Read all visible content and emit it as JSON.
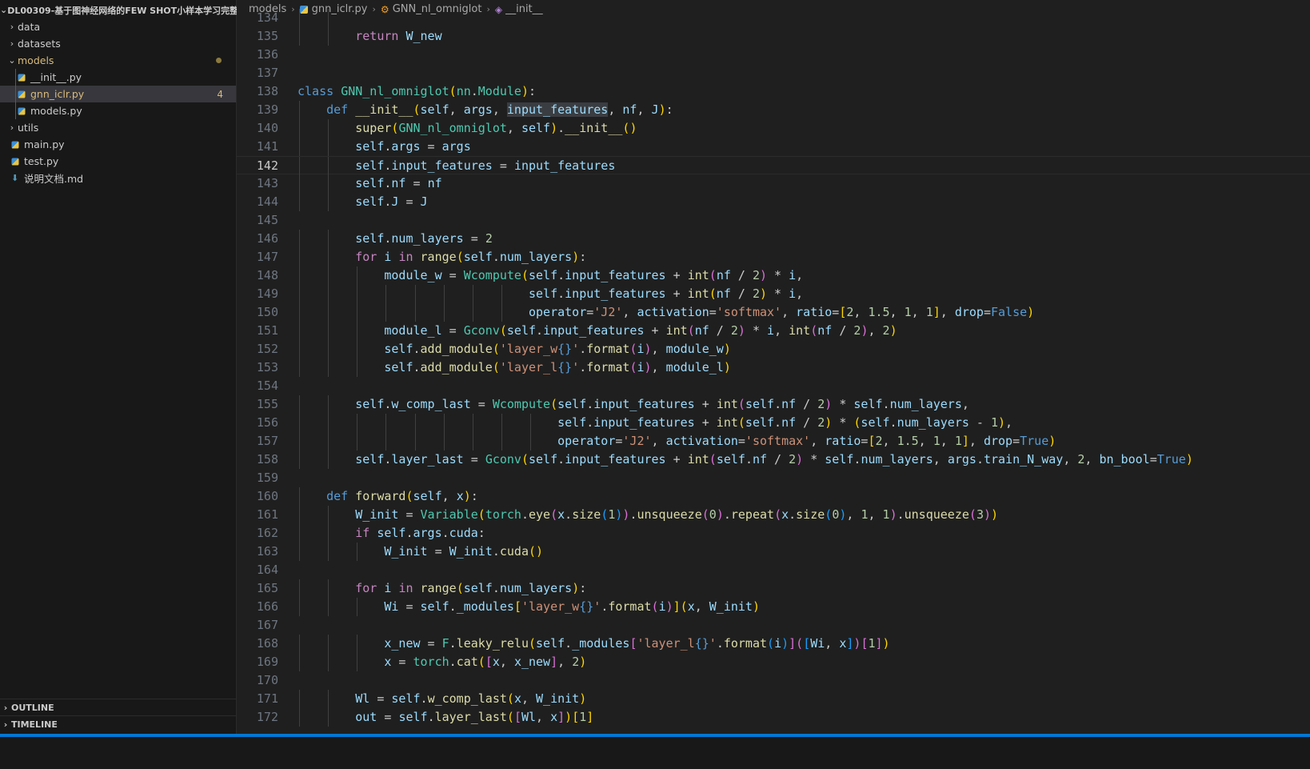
{
  "sidebar": {
    "root": "DL00309-基于图神经网络的FEW SHOT小样本学习完整...",
    "items": [
      {
        "label": "data",
        "type": "folder"
      },
      {
        "label": "datasets",
        "type": "folder"
      },
      {
        "label": "models",
        "type": "folder-open"
      },
      {
        "label": "__init__.py",
        "type": "py"
      },
      {
        "label": "gnn_iclr.py",
        "type": "py",
        "badge": "4"
      },
      {
        "label": "models.py",
        "type": "py"
      },
      {
        "label": "utils",
        "type": "folder"
      },
      {
        "label": "main.py",
        "type": "py"
      },
      {
        "label": "test.py",
        "type": "py"
      },
      {
        "label": "说明文档.md",
        "type": "md"
      }
    ],
    "outline": "OUTLINE",
    "timeline": "TIMELINE"
  },
  "breadcrumb": {
    "parts": [
      "models",
      "gnn_iclr.py",
      "GNN_nl_omniglot",
      "__init__"
    ]
  },
  "editor": {
    "current_line": "142",
    "lines": [
      {
        "n": "134",
        "text": "        return W_new"
      },
      {
        "n": "135",
        "text": "        return W_new"
      },
      {
        "n": "136",
        "text": ""
      },
      {
        "n": "137",
        "text": ""
      },
      {
        "n": "138",
        "text": "class GNN_nl_omniglot(nn.Module):"
      },
      {
        "n": "139",
        "text": "    def __init__(self, args, input_features, nf, J):"
      },
      {
        "n": "140",
        "text": "        super(GNN_nl_omniglot, self).__init__()"
      },
      {
        "n": "141",
        "text": "        self.args = args"
      },
      {
        "n": "142",
        "text": "        self.input_features = input_features"
      },
      {
        "n": "143",
        "text": "        self.nf = nf"
      },
      {
        "n": "144",
        "text": "        self.J = J"
      },
      {
        "n": "145",
        "text": ""
      },
      {
        "n": "146",
        "text": "        self.num_layers = 2"
      },
      {
        "n": "147",
        "text": "        for i in range(self.num_layers):"
      },
      {
        "n": "148",
        "text": "            module_w = Wcompute(self.input_features + int(nf / 2) * i,"
      },
      {
        "n": "149",
        "text": "                                self.input_features + int(nf / 2) * i,"
      },
      {
        "n": "150",
        "text": "                                operator='J2', activation='softmax', ratio=[2, 1.5, 1, 1], drop=False)"
      },
      {
        "n": "151",
        "text": "            module_l = Gconv(self.input_features + int(nf / 2) * i, int(nf / 2), 2)"
      },
      {
        "n": "152",
        "text": "            self.add_module('layer_w{}'.format(i), module_w)"
      },
      {
        "n": "153",
        "text": "            self.add_module('layer_l{}'.format(i), module_l)"
      },
      {
        "n": "154",
        "text": ""
      },
      {
        "n": "155",
        "text": "        self.w_comp_last = Wcompute(self.input_features + int(self.nf / 2) * self.num_layers,"
      },
      {
        "n": "156",
        "text": "                                    self.input_features + int(self.nf / 2) * (self.num_layers - 1),"
      },
      {
        "n": "157",
        "text": "                                    operator='J2', activation='softmax', ratio=[2, 1.5, 1, 1], drop=True)"
      },
      {
        "n": "158",
        "text": "        self.layer_last = Gconv(self.input_features + int(self.nf / 2) * self.num_layers, args.train_N_way, 2, bn_bool=True)"
      },
      {
        "n": "159",
        "text": ""
      },
      {
        "n": "160",
        "text": "    def forward(self, x):"
      },
      {
        "n": "161",
        "text": "        W_init = Variable(torch.eye(x.size(1)).unsqueeze(0).repeat(x.size(0), 1, 1).unsqueeze(3))"
      },
      {
        "n": "162",
        "text": "        if self.args.cuda:"
      },
      {
        "n": "163",
        "text": "            W_init = W_init.cuda()"
      },
      {
        "n": "164",
        "text": ""
      },
      {
        "n": "165",
        "text": "        for i in range(self.num_layers):"
      },
      {
        "n": "166",
        "text": "            Wi = self._modules['layer_w{}'.format(i)](x, W_init)"
      },
      {
        "n": "167",
        "text": ""
      },
      {
        "n": "168",
        "text": "            x_new = F.leaky_relu(self._modules['layer_l{}'.format(i)]([Wi, x])[1])"
      },
      {
        "n": "169",
        "text": "            x = torch.cat([x, x_new], 2)"
      },
      {
        "n": "170",
        "text": ""
      },
      {
        "n": "171",
        "text": "        Wl = self.w_comp_last(x, W_init)"
      },
      {
        "n": "172",
        "text": "        out = self.layer_last([Wl, x])[1]"
      }
    ]
  },
  "colors": {
    "status_bar": "#0078d4",
    "badge_text": "#d7ba7d",
    "keyword": "#569cd6",
    "class_name": "#4ec9b0",
    "function": "#dcdcaa",
    "string": "#ce9178",
    "number": "#b5cea8"
  }
}
